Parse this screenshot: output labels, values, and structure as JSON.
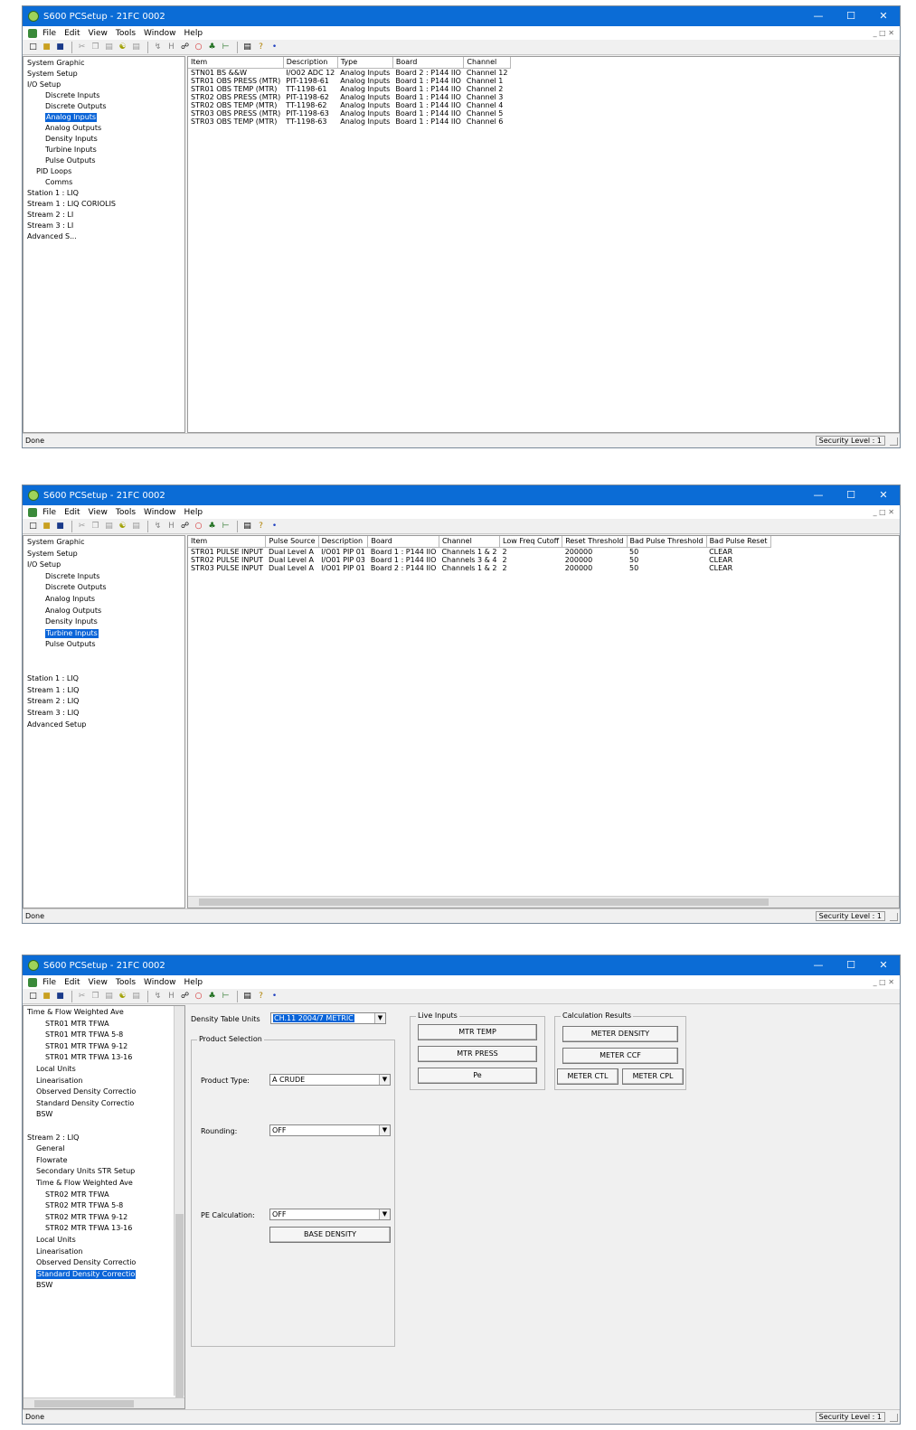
{
  "windows": [
    {
      "title": "S600 PCSetup - 21FC 0002",
      "menu": [
        "File",
        "Edit",
        "View",
        "Tools",
        "Window",
        "Help"
      ],
      "tree": [
        {
          "label": "System Graphic",
          "indent": 0
        },
        {
          "label": "System Setup",
          "indent": 0
        },
        {
          "label": "I/O Setup",
          "indent": 0
        },
        {
          "label": "Discrete Inputs",
          "indent": 2
        },
        {
          "label": "Discrete Outputs",
          "indent": 2
        },
        {
          "label": "Analog Inputs",
          "indent": 2,
          "selected": true
        },
        {
          "label": "Analog Outputs",
          "indent": 2
        },
        {
          "label": "Density Inputs",
          "indent": 2
        },
        {
          "label": "Turbine Inputs",
          "indent": 2
        },
        {
          "label": "Pulse Outputs",
          "indent": 2
        },
        {
          "label": "PID Loops",
          "indent": 1
        },
        {
          "label": "Comms",
          "indent": 2
        },
        {
          "label": "Station 1 : LIQ",
          "indent": 0
        },
        {
          "label": "Stream 1 : LIQ CORIOLIS",
          "indent": 0
        },
        {
          "label": "Stream 2 : LI",
          "indent": 0
        },
        {
          "label": "Stream 3 : LI",
          "indent": 0
        },
        {
          "label": "Advanced S...",
          "indent": 0
        }
      ],
      "columns": [
        "Item",
        "Description",
        "Type",
        "Board",
        "Channel"
      ],
      "rows": [
        [
          "STN01 BS &&W",
          "I/O02 ADC 12",
          "Analog Inputs",
          "Board 2 : P144 IIO",
          "Channel 12"
        ],
        [
          "STR01 OBS PRESS (MTR)",
          "PIT-1198-61",
          "Analog Inputs",
          "Board 1 : P144 IIO",
          "Channel 1"
        ],
        [
          "STR01 OBS TEMP (MTR)",
          "TT-1198-61",
          "Analog Inputs",
          "Board 1 : P144 IIO",
          "Channel 2"
        ],
        [
          "STR02 OBS PRESS (MTR)",
          "PIT-1198-62",
          "Analog Inputs",
          "Board 1 : P144 IIO",
          "Channel 3"
        ],
        [
          "STR02 OBS TEMP (MTR)",
          "TT-1198-62",
          "Analog Inputs",
          "Board 1 : P144 IIO",
          "Channel 4"
        ],
        [
          "STR03 OBS PRESS (MTR)",
          "PIT-1198-63",
          "Analog Inputs",
          "Board 1 : P144 IIO",
          "Channel 5"
        ],
        [
          "STR03 OBS TEMP (MTR)",
          "TT-1198-63",
          "Analog Inputs",
          "Board 1 : P144 IIO",
          "Channel 6"
        ]
      ],
      "status": "Done",
      "security": "Security Level : 1"
    },
    {
      "title": "S600 PCSetup - 21FC 0002",
      "menu": [
        "File",
        "Edit",
        "View",
        "Tools",
        "Window",
        "Help"
      ],
      "tree": [
        {
          "label": "System Graphic",
          "indent": 0
        },
        {
          "label": "System Setup",
          "indent": 0
        },
        {
          "label": "I/O Setup",
          "indent": 0
        },
        {
          "label": "Discrete Inputs",
          "indent": 2
        },
        {
          "label": "Discrete Outputs",
          "indent": 2
        },
        {
          "label": "Analog Inputs",
          "indent": 2
        },
        {
          "label": "Analog Outputs",
          "indent": 2
        },
        {
          "label": "Density Inputs",
          "indent": 2
        },
        {
          "label": "Turbine Inputs",
          "indent": 2,
          "selected": true
        },
        {
          "label": "Pulse Outputs",
          "indent": 2
        },
        {
          "label": "",
          "indent": 0
        },
        {
          "label": "",
          "indent": 0
        },
        {
          "label": "Station 1 : LIQ",
          "indent": 0
        },
        {
          "label": "Stream 1 : LIQ",
          "indent": 0
        },
        {
          "label": "Stream 2 : LIQ",
          "indent": 0
        },
        {
          "label": "Stream 3 : LIQ",
          "indent": 0
        },
        {
          "label": "Advanced Setup",
          "indent": 0
        }
      ],
      "columns": [
        "Item",
        "Pulse Source",
        "Description",
        "Board",
        "Channel",
        "Low Freq Cutoff",
        "Reset Threshold",
        "Bad Pulse Threshold",
        "Bad Pulse Reset"
      ],
      "rows": [
        [
          "STR01 PULSE INPUT",
          "Dual Level A",
          "I/O01 PIP 01",
          "Board 1 : P144 IIO",
          "Channels 1 & 2",
          "2",
          "200000",
          "50",
          "CLEAR"
        ],
        [
          "STR02 PULSE INPUT",
          "Dual Level A",
          "I/O01 PIP 03",
          "Board 1 : P144 IIO",
          "Channels 3 & 4",
          "2",
          "200000",
          "50",
          "CLEAR"
        ],
        [
          "STR03 PULSE INPUT",
          "Dual Level A",
          "I/O01 PIP 01",
          "Board 2 : P144 IIO",
          "Channels 1 & 2",
          "2",
          "200000",
          "50",
          "CLEAR"
        ]
      ],
      "status": "Done",
      "security": "Security Level : 1"
    },
    {
      "title": "S600 PCSetup - 21FC 0002",
      "menu": [
        "File",
        "Edit",
        "View",
        "Tools",
        "Window",
        "Help"
      ],
      "tree": [
        {
          "label": "Time & Flow Weighted Ave",
          "indent": 0
        },
        {
          "label": "STR01 MTR TFWA",
          "indent": 2
        },
        {
          "label": "STR01 MTR TFWA 5-8",
          "indent": 2
        },
        {
          "label": "STR01 MTR TFWA 9-12",
          "indent": 2
        },
        {
          "label": "STR01 MTR TFWA 13-16",
          "indent": 2
        },
        {
          "label": "Local Units",
          "indent": 1
        },
        {
          "label": "Linearisation",
          "indent": 1
        },
        {
          "label": "Observed Density Correctio",
          "indent": 1
        },
        {
          "label": "Standard Density Correctio",
          "indent": 1
        },
        {
          "label": "BSW",
          "indent": 1
        },
        {
          "label": "",
          "indent": 0
        },
        {
          "label": "Stream 2 : LIQ",
          "indent": 0
        },
        {
          "label": "General",
          "indent": 1
        },
        {
          "label": "Flowrate",
          "indent": 1
        },
        {
          "label": "Secondary Units STR Setup",
          "indent": 1
        },
        {
          "label": "Time & Flow Weighted Ave",
          "indent": 1
        },
        {
          "label": "STR02 MTR TFWA",
          "indent": 2
        },
        {
          "label": "STR02 MTR TFWA 5-8",
          "indent": 2
        },
        {
          "label": "STR02 MTR TFWA 9-12",
          "indent": 2
        },
        {
          "label": "STR02 MTR TFWA 13-16",
          "indent": 2
        },
        {
          "label": "Local Units",
          "indent": 1
        },
        {
          "label": "Linearisation",
          "indent": 1
        },
        {
          "label": "Observed Density Correctio",
          "indent": 1
        },
        {
          "label": "Standard Density Correctio",
          "indent": 1,
          "selected": true
        },
        {
          "label": "BSW",
          "indent": 1
        }
      ],
      "panel": {
        "density_label": "Density Table Units",
        "density_value": "CH.11 2004/7 METRIC",
        "product_group": "Product Selection",
        "product_type_label": "Product Type:",
        "product_type_value": "A CRUDE",
        "rounding_label": "Rounding:",
        "rounding_value": "OFF",
        "pe_label": "PE Calculation:",
        "pe_value": "OFF",
        "base_density_btn": "BASE DENSITY",
        "live_group": "Live Inputs",
        "mtr_temp_btn": "MTR TEMP",
        "mtr_press_btn": "MTR PRESS",
        "pe_btn": "Pe",
        "calc_group": "Calculation Results",
        "meter_density_btn": "METER DENSITY",
        "meter_ccf_btn": "METER CCF",
        "meter_ctl_btn": "METER CTL",
        "meter_cpl_btn": "METER CPL"
      },
      "status": "Done",
      "security": "Security Level : 1"
    }
  ]
}
